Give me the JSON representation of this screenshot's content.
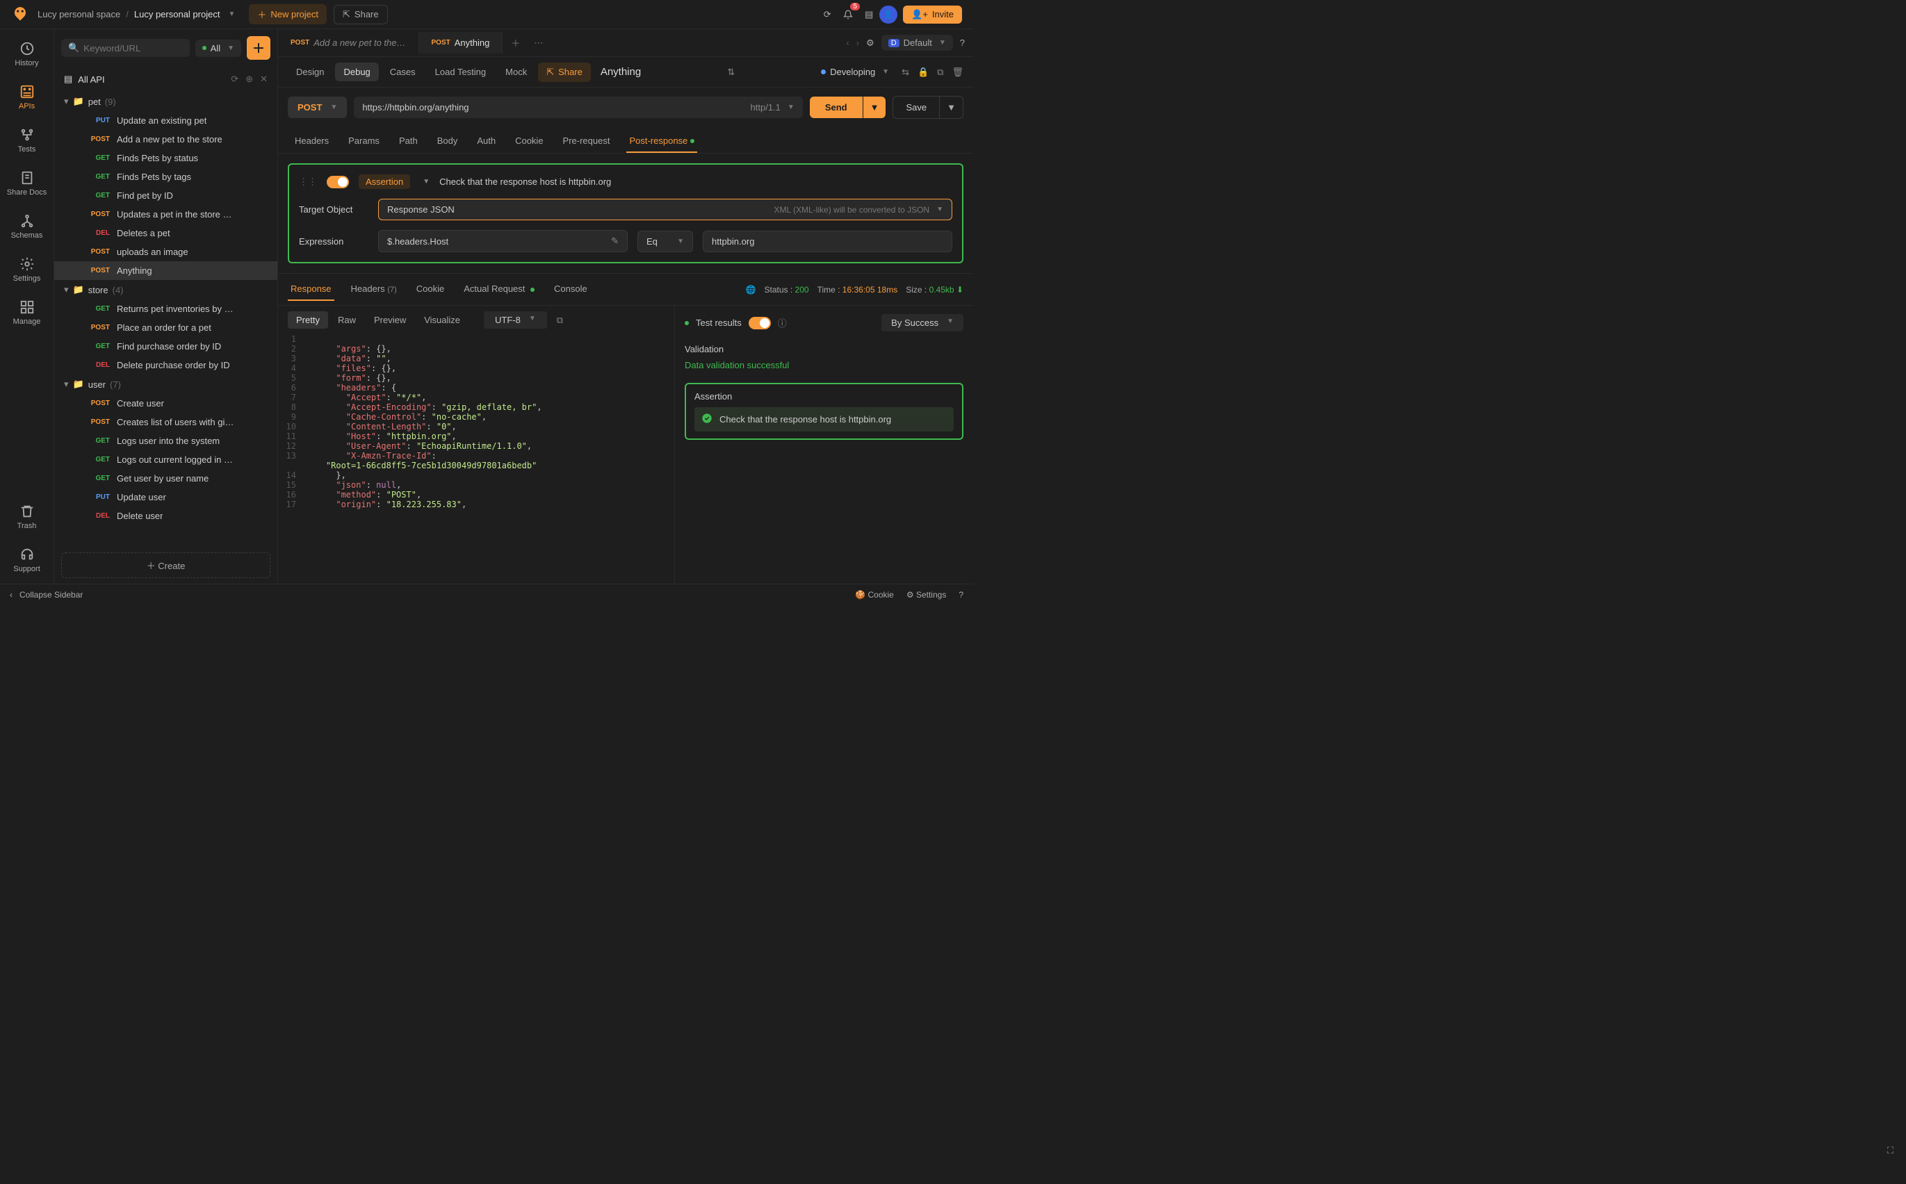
{
  "breadcrumb": {
    "workspace": "Lucy personal space",
    "project": "Lucy personal project"
  },
  "topbar": {
    "new_project": "New project",
    "share": "Share",
    "invite": "Invite",
    "notif_count": "5",
    "env_label": "Default",
    "env_badge": "D"
  },
  "leftnav": {
    "history": "History",
    "apis": "APIs",
    "tests": "Tests",
    "share_docs": "Share Docs",
    "schemas": "Schemas",
    "settings": "Settings",
    "manage": "Manage",
    "trash": "Trash",
    "support": "Support"
  },
  "sidebar": {
    "search_placeholder": "Keyword/URL",
    "filter_all": "All",
    "all_api": "All API",
    "create": "Create",
    "groups": [
      {
        "name": "pet",
        "count": "(9)",
        "items": [
          {
            "method": "PUT",
            "label": "Update an existing pet"
          },
          {
            "method": "POST",
            "label": "Add a new pet to the store"
          },
          {
            "method": "GET",
            "label": "Finds Pets by status"
          },
          {
            "method": "GET",
            "label": "Finds Pets by tags"
          },
          {
            "method": "GET",
            "label": "Find pet by ID"
          },
          {
            "method": "POST",
            "label": "Updates a pet in the store …"
          },
          {
            "method": "DEL",
            "label": "Deletes a pet"
          },
          {
            "method": "POST",
            "label": "uploads an image"
          },
          {
            "method": "POST",
            "label": "Anything",
            "selected": true
          }
        ]
      },
      {
        "name": "store",
        "count": "(4)",
        "items": [
          {
            "method": "GET",
            "label": "Returns pet inventories by …"
          },
          {
            "method": "POST",
            "label": "Place an order for a pet"
          },
          {
            "method": "GET",
            "label": "Find purchase order by ID"
          },
          {
            "method": "DEL",
            "label": "Delete purchase order by ID"
          }
        ]
      },
      {
        "name": "user",
        "count": "(7)",
        "items": [
          {
            "method": "POST",
            "label": "Create user"
          },
          {
            "method": "POST",
            "label": "Creates list of users with gi…"
          },
          {
            "method": "GET",
            "label": "Logs user into the system"
          },
          {
            "method": "GET",
            "label": "Logs out current logged in …"
          },
          {
            "method": "GET",
            "label": "Get user by user name"
          },
          {
            "method": "PUT",
            "label": "Update user"
          },
          {
            "method": "DEL",
            "label": "Delete user"
          }
        ]
      }
    ]
  },
  "tabs": [
    {
      "method": "POST",
      "title": "Add a new pet to the…"
    },
    {
      "method": "POST",
      "title": "Anything",
      "active": true
    }
  ],
  "subtabs": {
    "design": "Design",
    "debug": "Debug",
    "cases": "Cases",
    "load": "Load Testing",
    "mock": "Mock",
    "share": "Share"
  },
  "api": {
    "name": "Anything",
    "status": "Developing"
  },
  "request": {
    "method": "POST",
    "url": "https://httpbin.org/anything",
    "httpver": "http/1.1",
    "send": "Send",
    "save": "Save"
  },
  "reqtabs": {
    "headers": "Headers",
    "params": "Params",
    "path": "Path",
    "body": "Body",
    "auth": "Auth",
    "cookie": "Cookie",
    "pre": "Pre-request",
    "post": "Post-response"
  },
  "assertion": {
    "badge": "Assertion",
    "desc": "Check that the response host is httpbin.org",
    "target_label": "Target Object",
    "target_value": "Response JSON",
    "target_hint": "XML (XML-like) will be converted to JSON",
    "expr_label": "Expression",
    "expr_value": "$.headers.Host",
    "operator": "Eq",
    "expected": "httpbin.org"
  },
  "resp": {
    "tabs": {
      "response": "Response",
      "headers": "Headers",
      "headers_count": "(7)",
      "cookie": "Cookie",
      "actual": "Actual Request",
      "console": "Console"
    },
    "status_label": "Status :",
    "status_val": "200",
    "time_label": "Time :",
    "time_val": "16:36:05",
    "time_dur": "18ms",
    "size_label": "Size :",
    "size_val": "0.45kb",
    "toolbar": {
      "pretty": "Pretty",
      "raw": "Raw",
      "preview": "Preview",
      "visualize": "Visualize",
      "encoding": "UTF-8"
    },
    "lines": [
      {
        "n": "1",
        "indent": 2,
        "segs": []
      },
      {
        "n": "2",
        "indent": 3,
        "segs": [
          [
            "k",
            "\"args\""
          ],
          [
            "p",
            ": {},"
          ]
        ]
      },
      {
        "n": "3",
        "indent": 3,
        "segs": [
          [
            "k",
            "\"data\""
          ],
          [
            "p",
            ": "
          ],
          [
            "s",
            "\"\""
          ],
          [
            "p",
            ","
          ]
        ]
      },
      {
        "n": "4",
        "indent": 3,
        "segs": [
          [
            "k",
            "\"files\""
          ],
          [
            "p",
            ": {},"
          ]
        ]
      },
      {
        "n": "5",
        "indent": 3,
        "segs": [
          [
            "k",
            "\"form\""
          ],
          [
            "p",
            ": {},"
          ]
        ]
      },
      {
        "n": "6",
        "indent": 3,
        "segs": [
          [
            "k",
            "\"headers\""
          ],
          [
            "p",
            ": {"
          ]
        ]
      },
      {
        "n": "7",
        "indent": 4,
        "segs": [
          [
            "k",
            "\"Accept\""
          ],
          [
            "p",
            ": "
          ],
          [
            "s",
            "\"*/*\""
          ],
          [
            "p",
            ","
          ]
        ]
      },
      {
        "n": "8",
        "indent": 4,
        "segs": [
          [
            "k",
            "\"Accept-Encoding\""
          ],
          [
            "p",
            ": "
          ],
          [
            "s",
            "\"gzip, deflate, br\""
          ],
          [
            "p",
            ","
          ]
        ]
      },
      {
        "n": "9",
        "indent": 4,
        "segs": [
          [
            "k",
            "\"Cache-Control\""
          ],
          [
            "p",
            ": "
          ],
          [
            "s",
            "\"no-cache\""
          ],
          [
            "p",
            ","
          ]
        ]
      },
      {
        "n": "10",
        "indent": 4,
        "segs": [
          [
            "k",
            "\"Content-Length\""
          ],
          [
            "p",
            ": "
          ],
          [
            "s",
            "\"0\""
          ],
          [
            "p",
            ","
          ]
        ]
      },
      {
        "n": "11",
        "indent": 4,
        "segs": [
          [
            "k",
            "\"Host\""
          ],
          [
            "p",
            ": "
          ],
          [
            "s",
            "\"httpbin.org\""
          ],
          [
            "p",
            ","
          ]
        ]
      },
      {
        "n": "12",
        "indent": 4,
        "segs": [
          [
            "k",
            "\"User-Agent\""
          ],
          [
            "p",
            ": "
          ],
          [
            "s",
            "\"EchoapiRuntime/1.1.0\""
          ],
          [
            "p",
            ","
          ]
        ]
      },
      {
        "n": "13",
        "indent": 4,
        "segs": [
          [
            "k",
            "\"X-Amzn-Trace-Id\""
          ],
          [
            "p",
            ":"
          ]
        ]
      },
      {
        "n": "",
        "indent": 2,
        "segs": [
          [
            "s",
            "\"Root=1-66cd8ff5-7ce5b1d30049d97801a6bedb\""
          ]
        ]
      },
      {
        "n": "14",
        "indent": 3,
        "segs": [
          [
            "p",
            "},"
          ]
        ]
      },
      {
        "n": "15",
        "indent": 3,
        "segs": [
          [
            "k",
            "\"json\""
          ],
          [
            "p",
            ": "
          ],
          [
            "n",
            "null"
          ],
          [
            "p",
            ","
          ]
        ]
      },
      {
        "n": "16",
        "indent": 3,
        "segs": [
          [
            "k",
            "\"method\""
          ],
          [
            "p",
            ": "
          ],
          [
            "s",
            "\"POST\""
          ],
          [
            "p",
            ","
          ]
        ]
      },
      {
        "n": "17",
        "indent": 3,
        "segs": [
          [
            "k",
            "\"origin\""
          ],
          [
            "p",
            ": "
          ],
          [
            "s",
            "\"18.223.255.83\""
          ],
          [
            "p",
            ","
          ]
        ]
      }
    ]
  },
  "tests": {
    "title": "Test results",
    "sort": "By Success",
    "validation_h": "Validation",
    "validation_msg": "Data validation successful",
    "assertion_h": "Assertion",
    "assertion_msg": "Check that the response host is httpbin.org"
  },
  "footer": {
    "collapse": "Collapse Sidebar",
    "cookie": "Cookie",
    "settings": "Settings"
  }
}
